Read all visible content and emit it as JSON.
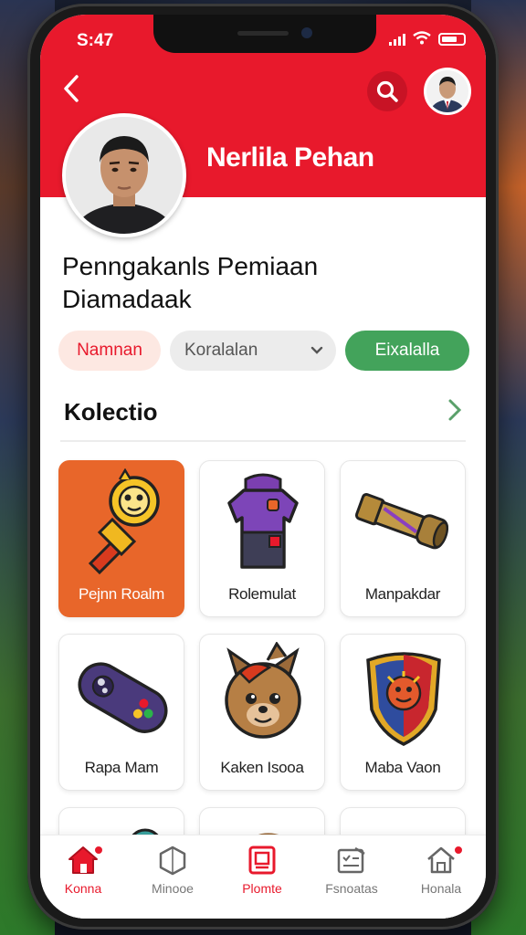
{
  "status": {
    "time": "S:47"
  },
  "header": {
    "profile_name": "Nerlila Pehan",
    "back_icon": "chevron-left-icon",
    "search_icon": "search-icon"
  },
  "page": {
    "title_line1": "Penngakanls Pemiaan",
    "title_line2": "Diamadaak"
  },
  "chips": {
    "chip1": "Namnan",
    "chip2": "Koralalan",
    "chip3": "Eixalalla"
  },
  "section": {
    "title": "Kolectio"
  },
  "items": [
    {
      "label": "Pejnn Roalm",
      "icon": "golden-scepter-icon"
    },
    {
      "label": "Rolemulat",
      "icon": "jersey-icon"
    },
    {
      "label": "Manpakdar",
      "icon": "telescope-icon"
    },
    {
      "label": "Rapa Mam",
      "icon": "gamepad-icon"
    },
    {
      "label": "Kaken Isooa",
      "icon": "bear-mascot-icon"
    },
    {
      "label": "Maba Vaon",
      "icon": "crest-shield-icon"
    }
  ],
  "nav": [
    {
      "label": "Konna",
      "icon": "home-icon"
    },
    {
      "label": "Minooe",
      "icon": "hexagon-icon"
    },
    {
      "label": "Plomte",
      "icon": "frame-icon"
    },
    {
      "label": "Fsnoatas",
      "icon": "checklist-icon"
    },
    {
      "label": "Honala",
      "icon": "home-outline-icon"
    }
  ],
  "colors": {
    "brand_red": "#e8192c",
    "active_card": "#e8662a",
    "green": "#43a35b"
  }
}
